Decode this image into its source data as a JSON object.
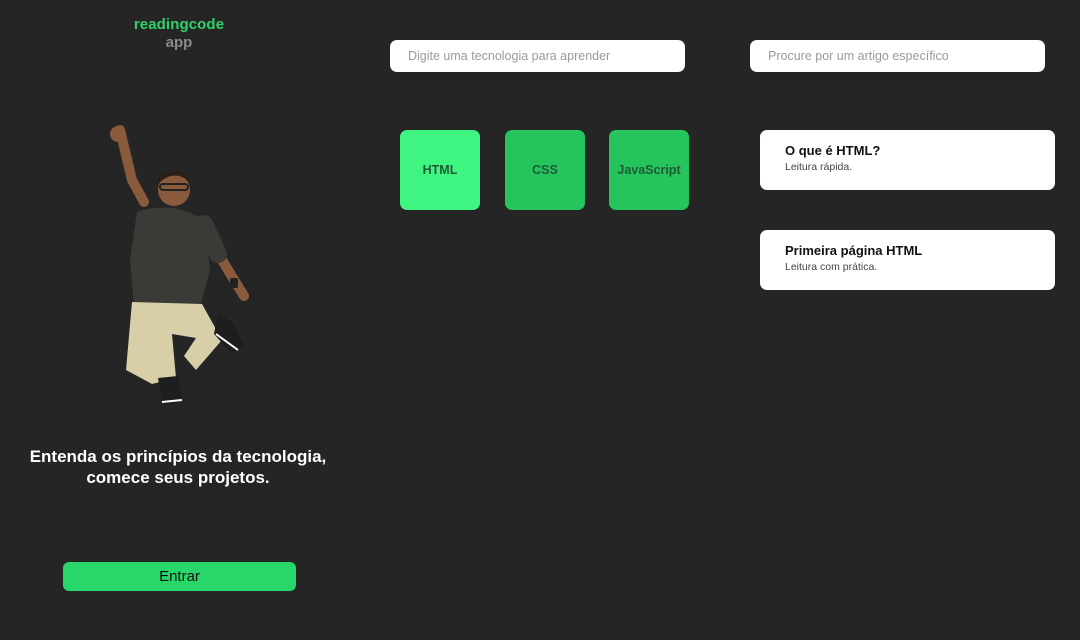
{
  "logo": {
    "line1": "readingcode",
    "line2": "app"
  },
  "hero": {
    "tagline_line1": "Entenda os princípios da tecnologia,",
    "tagline_line2": "comece seus projetos.",
    "enter_label": "Entrar"
  },
  "search": {
    "tech_placeholder": "Digite uma tecnologia para aprender",
    "article_placeholder": "Procure por um artigo específico"
  },
  "technologies": [
    {
      "label": "HTML"
    },
    {
      "label": "CSS"
    },
    {
      "label": "JavaScript"
    }
  ],
  "articles": [
    {
      "title": "O que é HTML?",
      "subtitle": "Leitura rápida."
    },
    {
      "title": "Primeira página HTML",
      "subtitle": "Leitura com prática."
    }
  ],
  "colors": {
    "background": "#252525",
    "brand_green": "#2fd36a",
    "tile_active": "#3ef581",
    "tile": "#26c45d",
    "button": "#29d669"
  }
}
